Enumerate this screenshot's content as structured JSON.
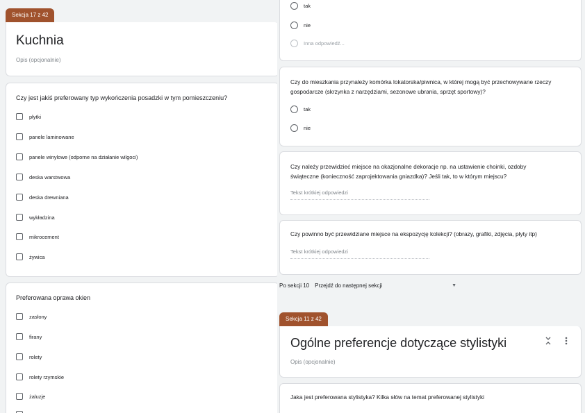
{
  "left": {
    "section_tag": "Sekcja 17 z 42",
    "section_title": "Kuchnia",
    "section_desc": "Opis (opcjonalnie)",
    "q1": {
      "text": "Czy jest jakiś preferowany typ wykończenia posadzki w tym pomieszczeniu?",
      "options": [
        "płytki",
        "panele laminowane",
        "panele winylowe (odporne na działanie wilgoci)",
        "deska warstwowa",
        "deska drewniana",
        "wykładzina",
        "mikrocement",
        "żywica"
      ]
    },
    "q2": {
      "text": "Preferowana oprawa okien",
      "options": [
        "zasłony",
        "firany",
        "rolety",
        "rolety rzymskie",
        "żaluzje"
      ]
    }
  },
  "right": {
    "q_top_options": [
      "tak",
      "nie",
      "Inna odpowiedź..."
    ],
    "q_storage": {
      "text": "Czy do mieszkania przynależy komórka lokatorska/piwnica, w której mogą być przechowywane rzeczy gospodarcze (skrzynka z narzędziami, sezonowe ubrania, sprzęt sportowy)?",
      "options": [
        "tak",
        "nie"
      ]
    },
    "q_decor": {
      "text": "Czy należy przewidzieć miejsce na okazjonalne dekoracje np. na ustawienie choinki, ozdoby świąteczne (konieczność zaprojektowania gniazdka)? Jeśli tak, to w którym miejscu?",
      "placeholder": "Tekst krótkiej odpowiedzi"
    },
    "q_collection": {
      "text": "Czy powinno być przewidziane miejsce na ekspozycję kolekcji? (obrazy, grafiki, zdjęcia, płyty itp)",
      "placeholder": "Tekst krótkiej odpowiedzi"
    },
    "after_section": {
      "label": "Po sekcji 10",
      "value": "Przejdź do następnej sekcji"
    },
    "section_tag": "Sekcja 11 z 42",
    "section_title": "Ogólne preferencje dotyczące stylistyki",
    "section_desc": "Opis (opcjonalnie)",
    "q_style": {
      "text": "Jaka jest preferowana stylistyka? Kilka słów na temat preferowanej stylistyki"
    }
  }
}
